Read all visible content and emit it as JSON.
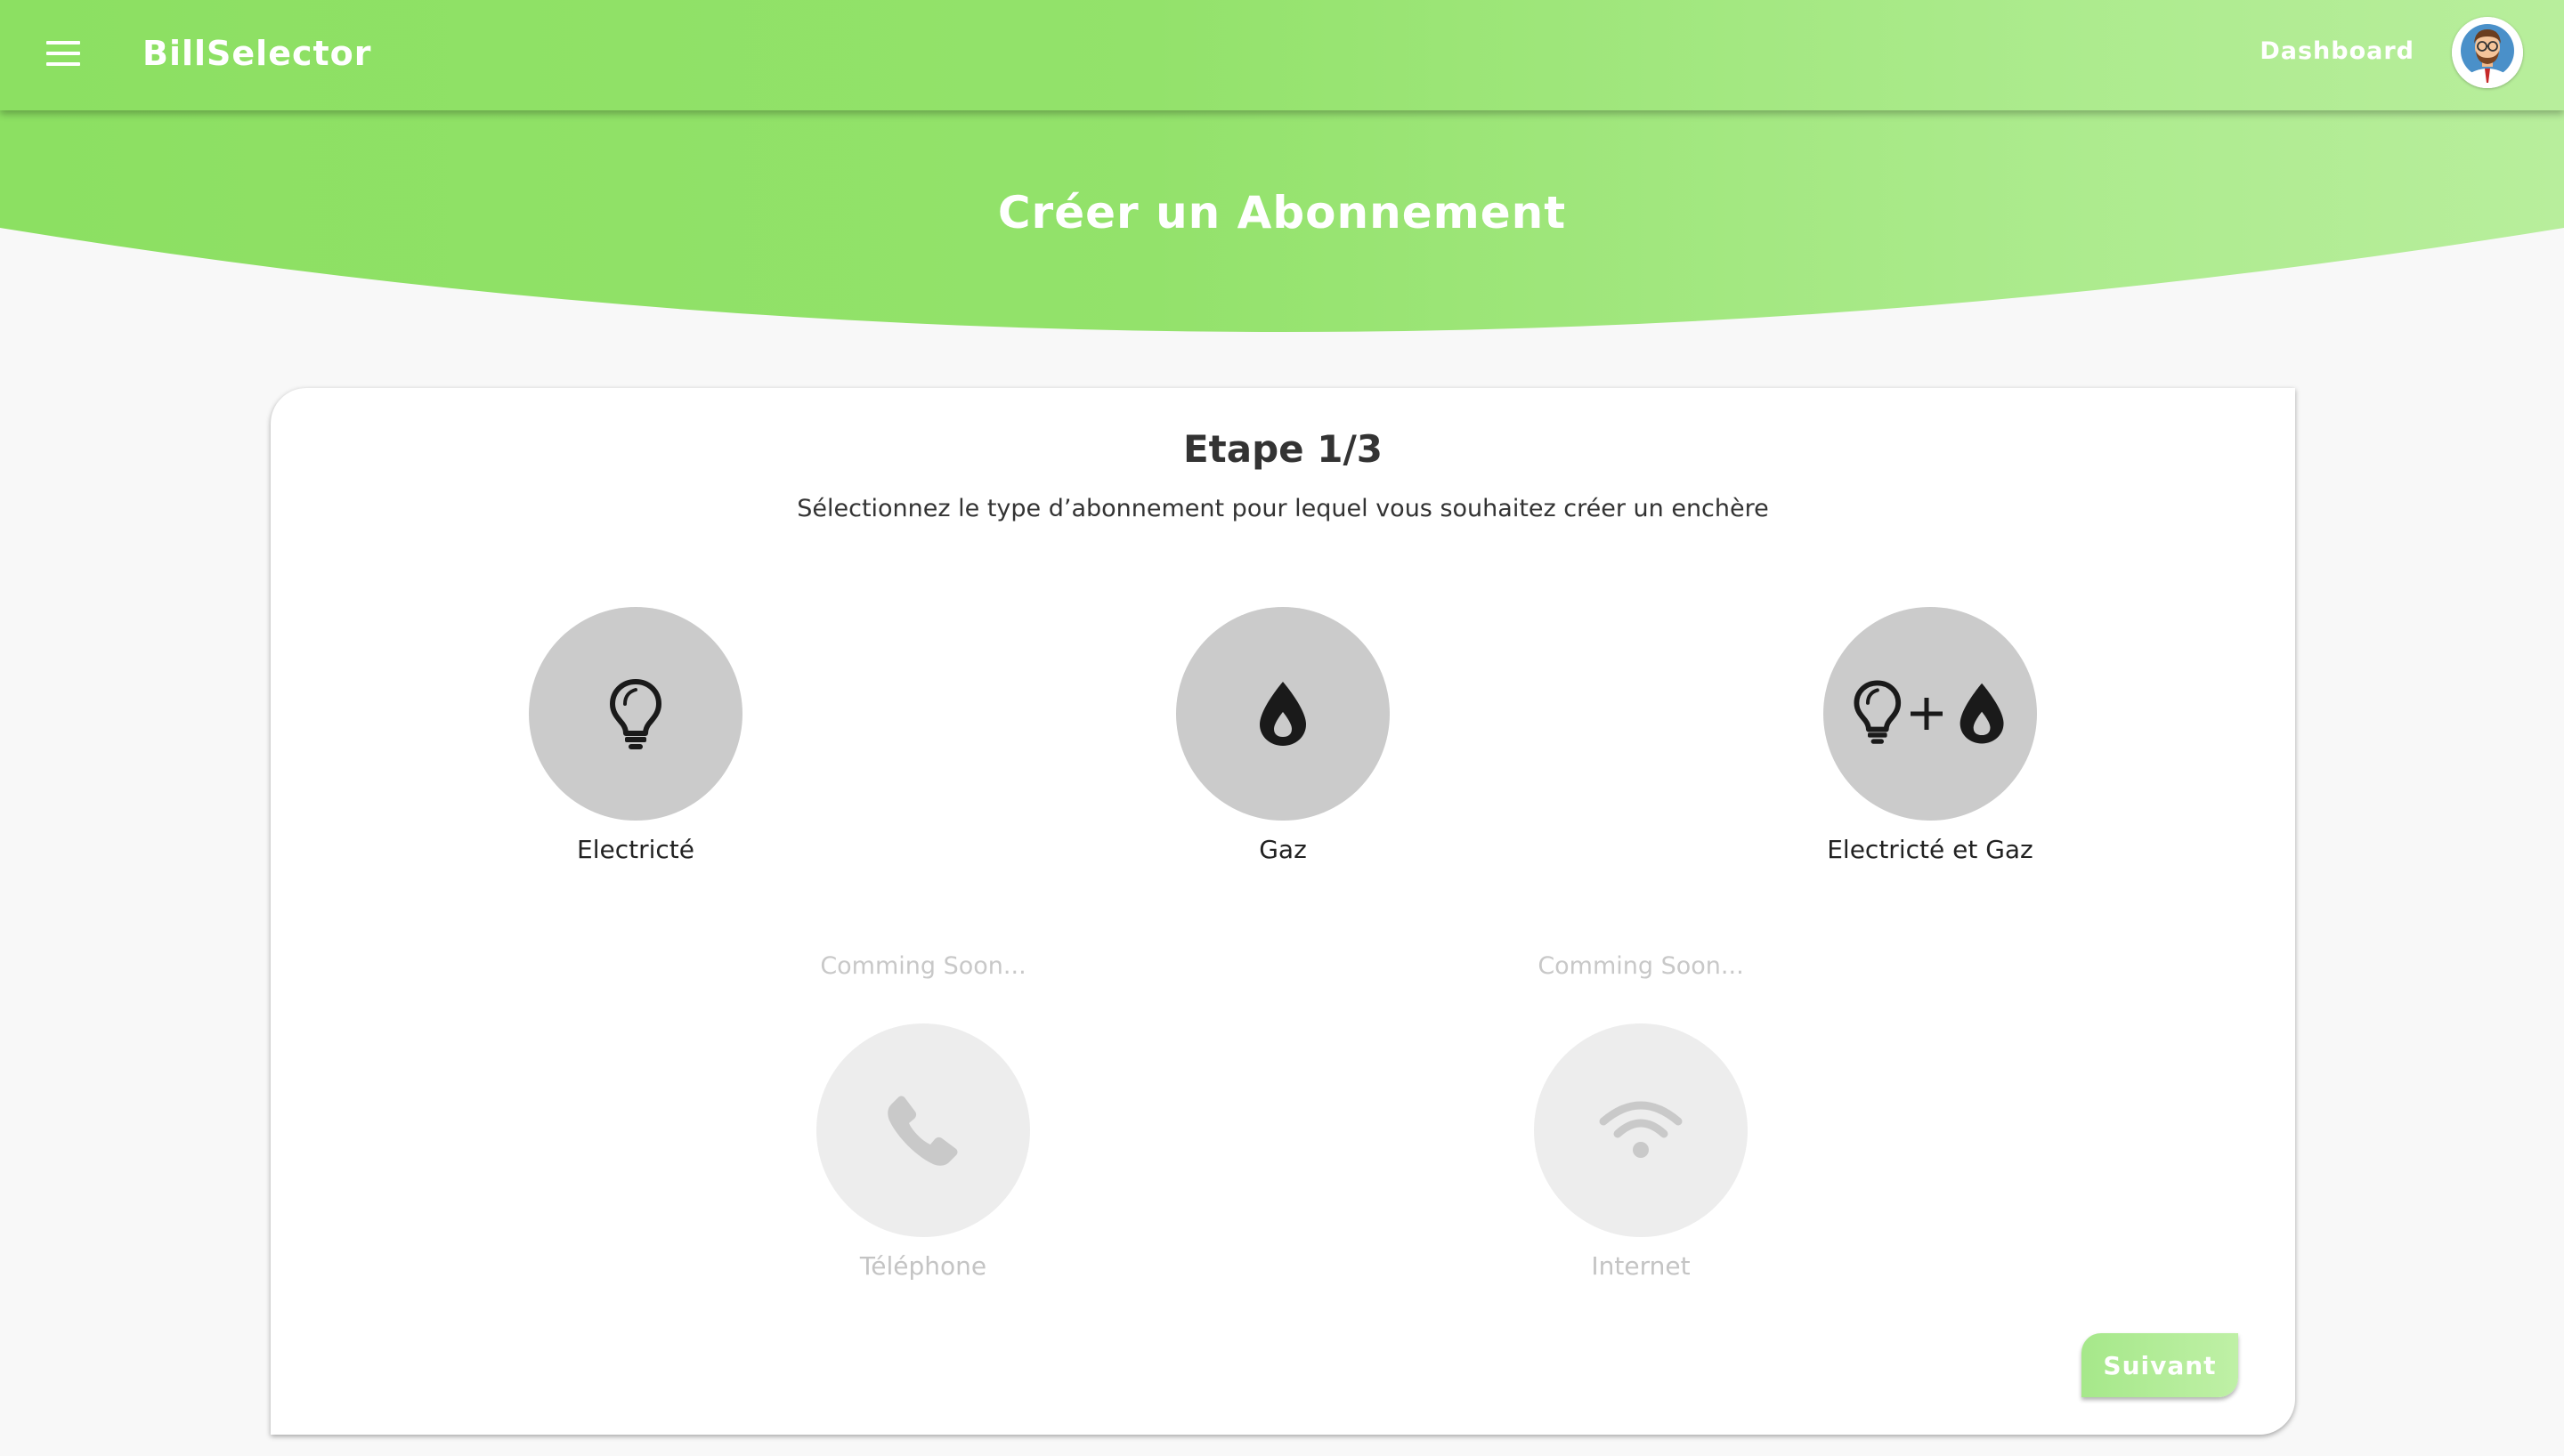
{
  "app": {
    "brand": "BillSelector",
    "nav_dashboard": "Dashboard",
    "menu_icon": "hamburger-menu-icon",
    "avatar_icon": "user-avatar-icon"
  },
  "hero": {
    "title": "Créer un Abonnement"
  },
  "wizard": {
    "step_title": "Etape 1/3",
    "instructions": "Sélectionnez le type d’abonnement pour lequel vous souhaitez créer un enchère",
    "options": [
      {
        "id": "electricity",
        "label": "Electricté",
        "icon": "lightbulb-icon",
        "status": "available"
      },
      {
        "id": "gas",
        "label": "Gaz",
        "icon": "flame-drop-icon",
        "status": "available"
      },
      {
        "id": "electricity-gas",
        "label": "Electricté et Gaz",
        "icon": "lightbulb-plus-flame-icon",
        "status": "available"
      },
      {
        "id": "phone",
        "label": "Téléphone",
        "icon": "phone-icon",
        "status": "coming-soon",
        "soon_text": "Comming Soon..."
      },
      {
        "id": "internet",
        "label": "Internet",
        "icon": "wifi-icon",
        "status": "coming-soon",
        "soon_text": "Comming Soon..."
      }
    ],
    "next_label": "Suivant"
  },
  "colors": {
    "header_green": "#8ce062",
    "header_green_light": "#b8ee9c",
    "option_circle": "#cbcbcb",
    "option_circle_disabled": "#ededed",
    "disabled_text": "#c4c4c4",
    "page_background": "#f8f8f8"
  }
}
